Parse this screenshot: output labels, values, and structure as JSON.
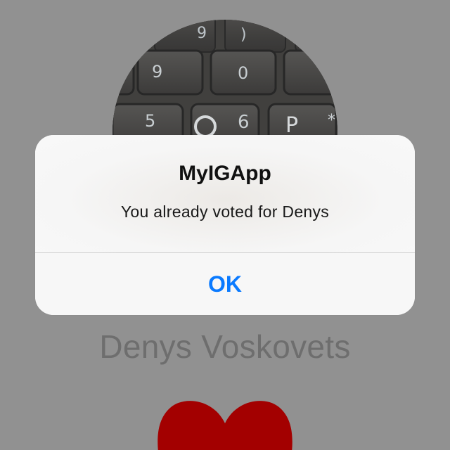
{
  "profile": {
    "name": "Denys Voskovets",
    "photo_icon": "keyboard-photo",
    "heart_color": "#a30000"
  },
  "alert": {
    "title": "MyIGApp",
    "message": "You already voted for Denys",
    "ok_label": "OK",
    "button_color": "#0a7aff"
  },
  "keyboard": {
    "keys": [
      "9",
      ")",
      "9",
      "0",
      "5",
      "6",
      "P",
      "*"
    ]
  }
}
